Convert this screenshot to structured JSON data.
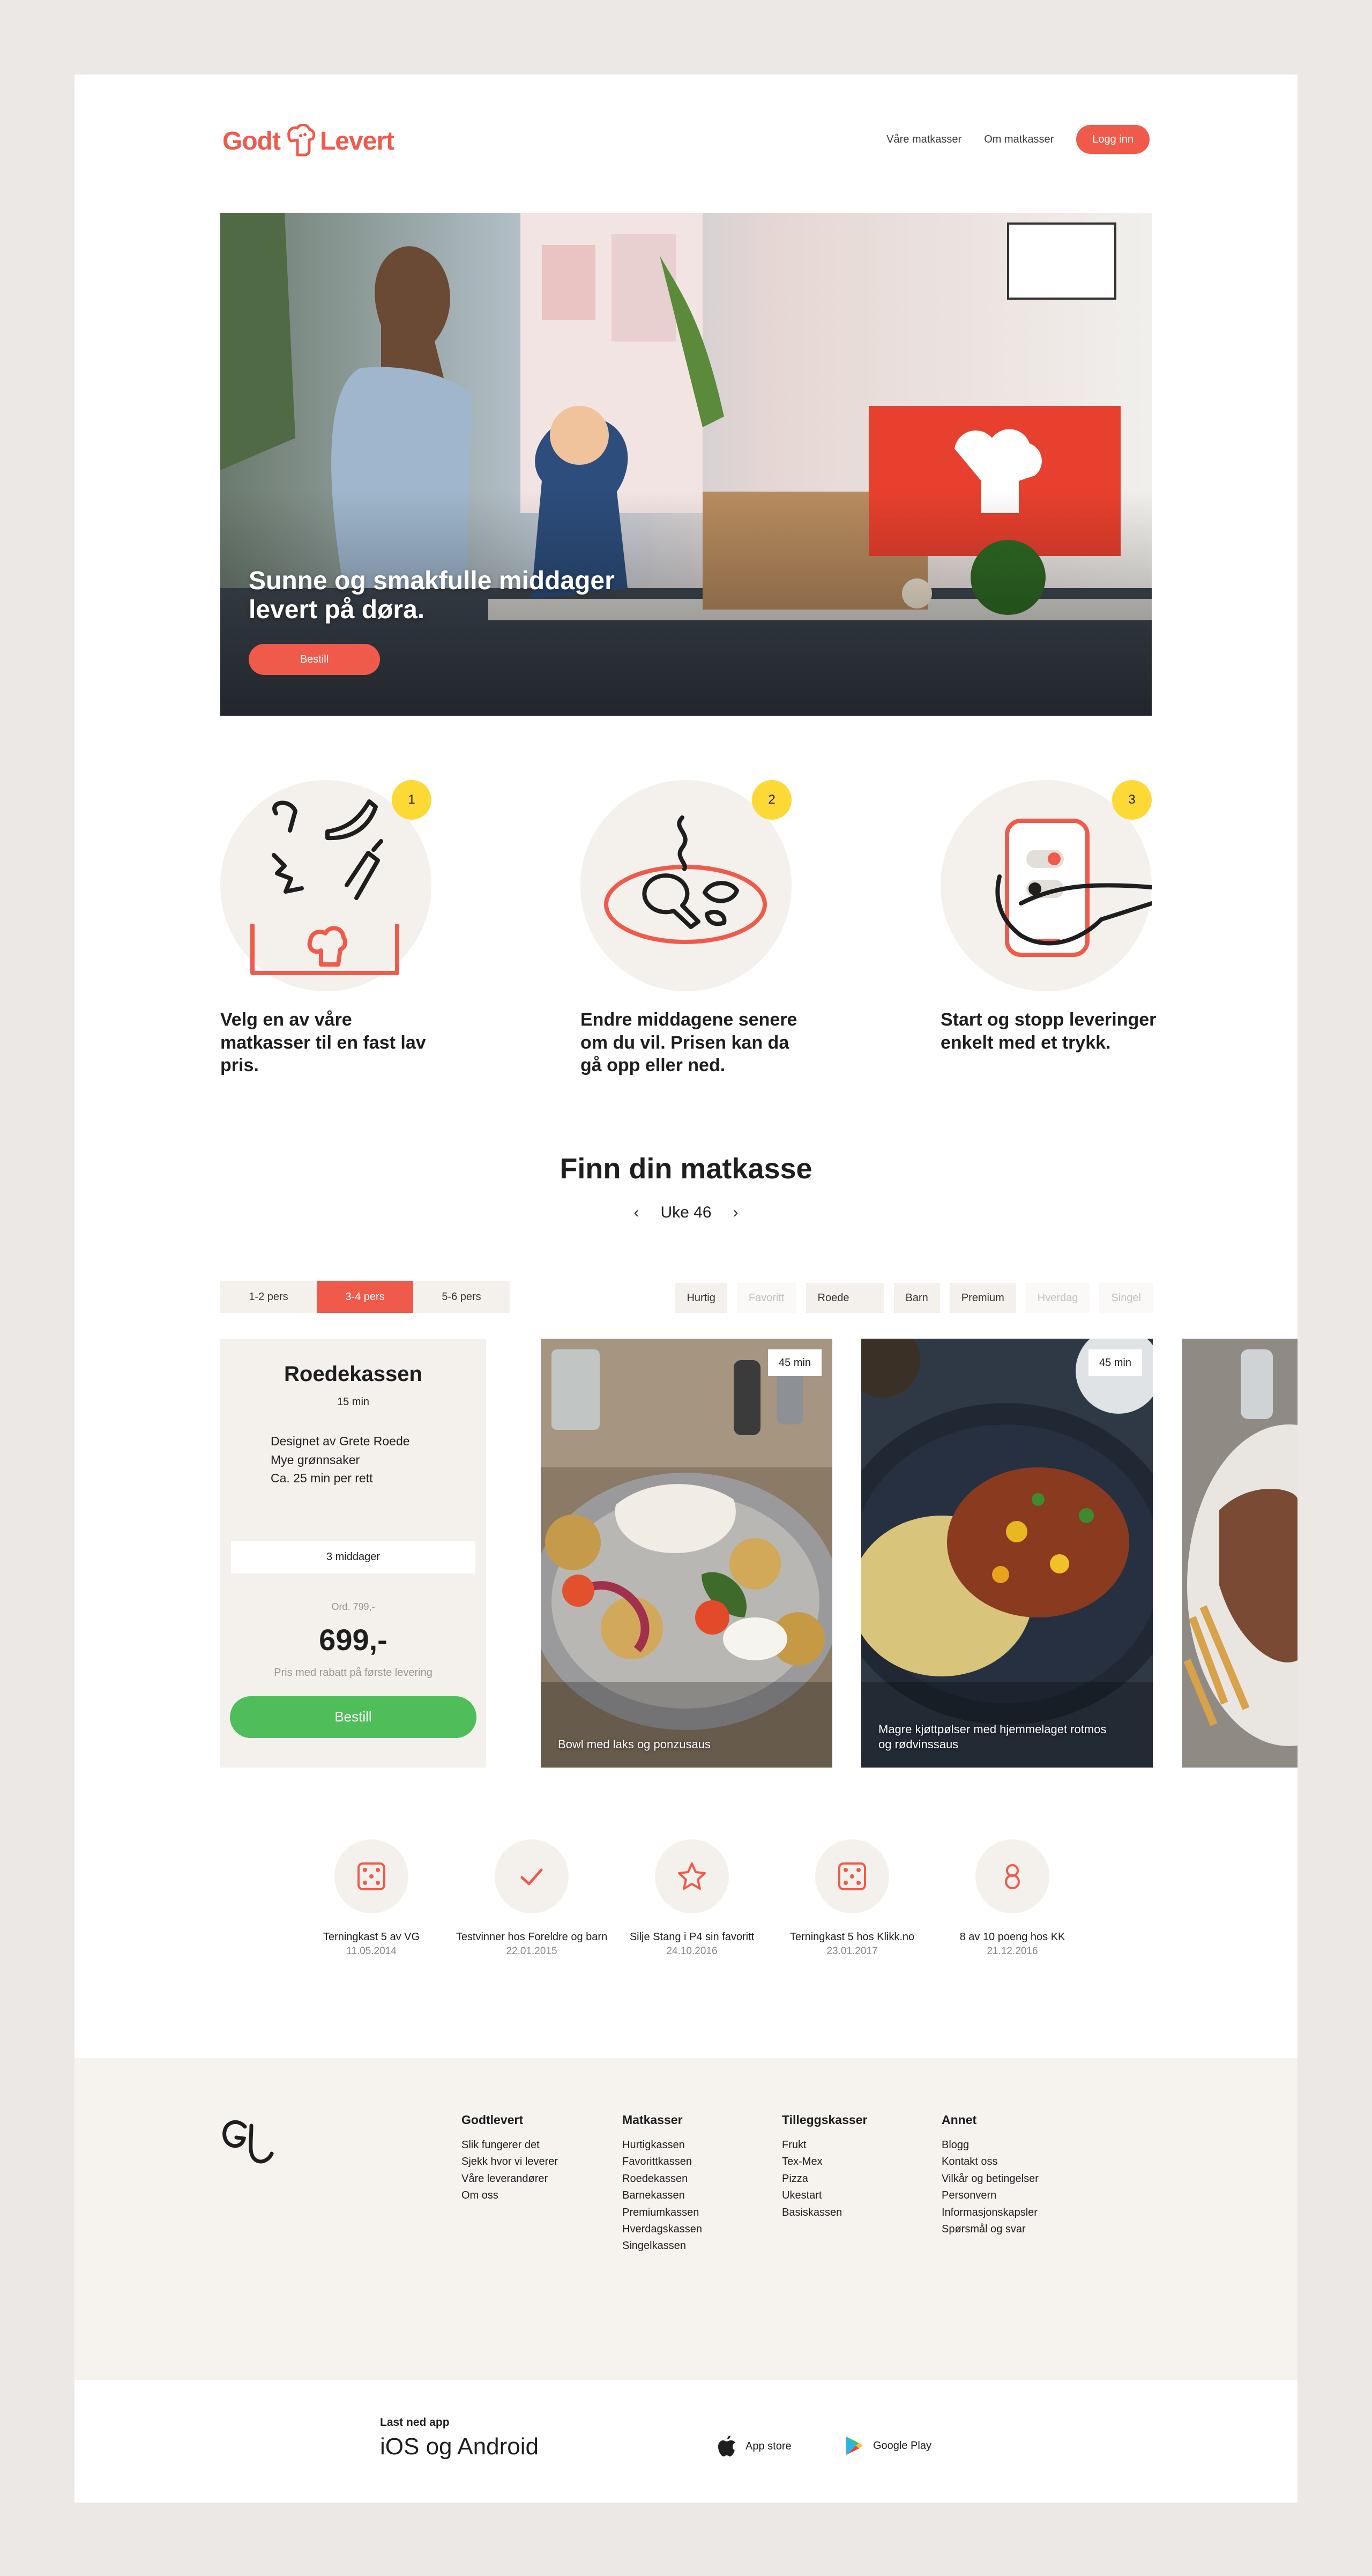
{
  "header": {
    "logo_left": "Godt",
    "logo_right": "Levert",
    "nav": [
      "Våre matkasser",
      "Om matkasser"
    ],
    "login": "Logg inn"
  },
  "hero": {
    "title": "Sunne og smakfulle middager levert på døra.",
    "button": "Bestill"
  },
  "steps": [
    {
      "num": "1",
      "text": "Velg en av våre matkasser til en fast lav pris."
    },
    {
      "num": "2",
      "text": "Endre middagene senere om du vil. Prisen kan da gå opp eller ned."
    },
    {
      "num": "3",
      "text": "Start og stopp leveringer enkelt med et trykk."
    }
  ],
  "finn": {
    "title": "Finn din matkasse",
    "week": "Uke 46",
    "prev": "‹",
    "next": "›"
  },
  "sizes": [
    {
      "label": "1-2 pers",
      "active": false
    },
    {
      "label": "3-4 pers",
      "active": true
    },
    {
      "label": "5-6 pers",
      "active": false
    }
  ],
  "filters": [
    {
      "label": "Hurtig",
      "enabled": true
    },
    {
      "label": "Favoritt",
      "enabled": false
    },
    {
      "label": "Roede",
      "enabled": true
    },
    {
      "label": "Barn",
      "enabled": true
    },
    {
      "label": "Premium",
      "enabled": true
    },
    {
      "label": "Hverdag",
      "enabled": false
    },
    {
      "label": "Singel",
      "enabled": false
    }
  ],
  "box": {
    "name": "Roedekassen",
    "time": "15 min",
    "desc": [
      "Designet av Grete Roede",
      "Mye grønnsaker",
      "Ca. 25 min per rett"
    ],
    "meals": "3 middager",
    "ord": "Ord. 799,-",
    "price": "699,-",
    "rabatt": "Pris med rabatt på første levering",
    "button": "Bestill"
  },
  "dishes": [
    {
      "time": "45 min",
      "name": "Bowl med laks og ponzusaus"
    },
    {
      "time": "45 min",
      "name": "Magre kjøttpølser med hjemmelaget rotmos og rødvinssaus"
    }
  ],
  "awards": [
    {
      "icon": "dice-icon",
      "title": "Terningkast 5 av VG",
      "date": "11.05.2014"
    },
    {
      "icon": "check-icon",
      "title": "Testvinner hos Foreldre og barn",
      "date": "22.01.2015"
    },
    {
      "icon": "star-icon",
      "title": "Silje Stang i P4 sin favoritt",
      "date": "24.10.2016"
    },
    {
      "icon": "dice-icon",
      "title": "Terningkast 5 hos Klikk.no",
      "date": "23.01.2017"
    },
    {
      "icon": "eight-icon",
      "title": "8 av 10 poeng hos KK",
      "date": "21.12.2016"
    }
  ],
  "footer": {
    "columns": [
      {
        "title": "Godtlevert",
        "links": [
          "Slik fungerer det",
          "Sjekk hvor vi leverer",
          "Våre leverandører",
          "Om oss"
        ]
      },
      {
        "title": "Matkasser",
        "links": [
          "Hurtigkassen",
          "Favorittkassen",
          "Roedekassen",
          "Barnekassen",
          "Premiumkassen",
          "Hverdagskassen",
          "Singelkassen"
        ]
      },
      {
        "title": "Tilleggskasser",
        "links": [
          "Frukt",
          "Tex-Mex",
          "Pizza",
          "Ukestart",
          "Basiskassen"
        ]
      },
      {
        "title": "Annet",
        "links": [
          "Blogg",
          "Kontakt oss",
          "Vilkår og betingelser",
          "Personvern",
          "Informasjonskapsler",
          "Spørsmål og svar"
        ]
      }
    ],
    "app_label": "Last ned app",
    "app_title": "iOS og Android",
    "app_store": "App store",
    "google_play": "Google Play"
  },
  "colors": {
    "accent": "#f05a4b",
    "green": "#4ebd5a",
    "yellow": "#fcd935",
    "beige": "#f4f1ed"
  }
}
